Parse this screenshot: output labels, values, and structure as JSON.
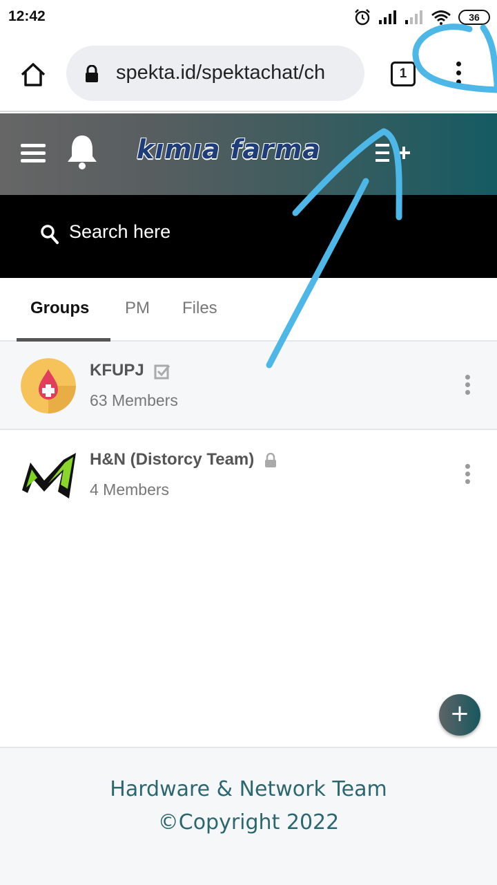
{
  "status_bar": {
    "time": "12:42",
    "battery": "36",
    "icons": [
      "alarm-icon",
      "signal-icon",
      "signal-weak-icon",
      "wifi-icon",
      "battery-icon"
    ]
  },
  "browser": {
    "url": "spekta.id/spektachat/ch",
    "tab_count": "1",
    "icons": [
      "home-icon",
      "lock-icon",
      "more-vert-icon"
    ]
  },
  "header": {
    "brand": "kımıa farma",
    "icons": [
      "menu-icon",
      "bell-icon",
      "playlist-add-icon"
    ],
    "gradient": [
      "#666666",
      "#155b62"
    ]
  },
  "search": {
    "placeholder": "Search here"
  },
  "tabs": [
    {
      "label": "Groups",
      "active": true
    },
    {
      "label": "PM",
      "active": false
    },
    {
      "label": "Files",
      "active": false
    }
  ],
  "groups": [
    {
      "name": "KFUPJ",
      "members": "63 Members",
      "badge": "verified-check-icon"
    },
    {
      "name": "H&N (Distorcy Team)",
      "members": "4 Members",
      "badge": "lock-icon"
    }
  ],
  "fab": {
    "label": "+"
  },
  "footer": {
    "line1": "Hardware & Network Team",
    "line2": "©Copyright 2022"
  },
  "colors": {
    "accent": "#2c6770",
    "annotation": "#4db8e8"
  }
}
